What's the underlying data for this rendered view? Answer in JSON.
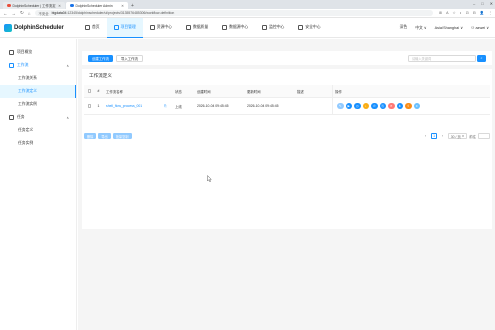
{
  "browser": {
    "tabs": [
      {
        "title": "DolphinScheduler | 工作流定",
        "icon_color": "#e84e3c"
      },
      {
        "title": "DolphinScheduler Admin",
        "icon_color": "#1a73e8"
      }
    ],
    "new_tab": "+",
    "window_controls": [
      "–",
      "□",
      "✕"
    ],
    "nav": {
      "back": "←",
      "forward": "→",
      "reload": "↻",
      "home": "⌂"
    },
    "url_insecure": "不安全",
    "url_host": "bigdata04",
    "url_rest": ":12345/dolphinscheduler/ui/projects/3135576485306/workflow-definition",
    "extension_icons": [
      "⊞",
      "A",
      "☆",
      "◐",
      "⊡",
      "⊟",
      "👤",
      "⋮"
    ]
  },
  "app": {
    "brand": "DolphinScheduler",
    "brand_color": "#1890ff",
    "nav": [
      {
        "label": "首页",
        "icon": "home-icon"
      },
      {
        "label": "项目管理",
        "icon": "project-icon",
        "active": true
      },
      {
        "label": "资源中心",
        "icon": "folder-icon"
      },
      {
        "label": "数据质量",
        "icon": "quality-icon"
      },
      {
        "label": "数据源中心",
        "icon": "datasource-icon"
      },
      {
        "label": "监控中心",
        "icon": "monitor-icon"
      },
      {
        "label": "安全中心",
        "icon": "security-icon"
      }
    ],
    "header_right": {
      "theme": "深色",
      "language": "中文",
      "language_caret": "∨",
      "timezone": "Asia/Shanghai",
      "timezone_caret": "∨",
      "user": "azwei",
      "user_caret": "∨"
    }
  },
  "sidebar": {
    "overview": "项目概览",
    "workflow_group": "工作流",
    "workflow_caret": "∧",
    "workflow_items": [
      {
        "label": "工作流关系"
      },
      {
        "label": "工作流定义",
        "active": true
      },
      {
        "label": "工作流实例"
      }
    ],
    "task_group": "任务",
    "task_caret": "∧",
    "task_items": [
      {
        "label": "任务定义"
      },
      {
        "label": "任务实例"
      }
    ]
  },
  "page": {
    "create_button": "创建工作流",
    "import_button": "导入工作流",
    "search_placeholder": "请输入关键词",
    "search_icon": "⌕",
    "panel_title": "工作流定义",
    "columns": {
      "no": "#",
      "name": "工作流名称",
      "state": "状态",
      "create_time": "创建时间",
      "update_time": "更新时间",
      "description": "描述",
      "operation": "操作"
    },
    "rows": [
      {
        "no": "1",
        "name": "shell_flow_process_001",
        "edit_icon": "⎘",
        "state": "上线",
        "create_time": "2026-10-04 09:45:45",
        "update_time": "2026-10-04 09:45:45",
        "description": ""
      }
    ],
    "row_operations": [
      {
        "name": "edit-op-icon",
        "color": "#91caff",
        "glyph": "✎"
      },
      {
        "name": "run-op-icon",
        "color": "#1890ff",
        "glyph": "▶"
      },
      {
        "name": "timing-op-icon",
        "color": "#1890ff",
        "glyph": "◷"
      },
      {
        "name": "online-op-icon",
        "color": "#faad14",
        "glyph": "↓"
      },
      {
        "name": "cron-op-icon",
        "color": "#1890ff",
        "glyph": "⏱"
      },
      {
        "name": "copy-op-icon",
        "color": "#1890ff",
        "glyph": "⎘"
      },
      {
        "name": "delete-op-icon",
        "color": "#ff7875",
        "glyph": "✕"
      },
      {
        "name": "tree-op-icon",
        "color": "#1890ff",
        "glyph": "⋔"
      },
      {
        "name": "export-op-icon",
        "color": "#fa8c16",
        "glyph": "⇪"
      },
      {
        "name": "version-op-icon",
        "color": "#69c0ff",
        "glyph": "≡"
      }
    ],
    "batch_buttons": [
      "删除",
      "导出",
      "批量复制"
    ],
    "pagination": {
      "prev": "‹",
      "current": "1",
      "next": "›",
      "page_size": "30 / 页",
      "page_size_caret": "∨",
      "jump_label": "前往"
    }
  }
}
